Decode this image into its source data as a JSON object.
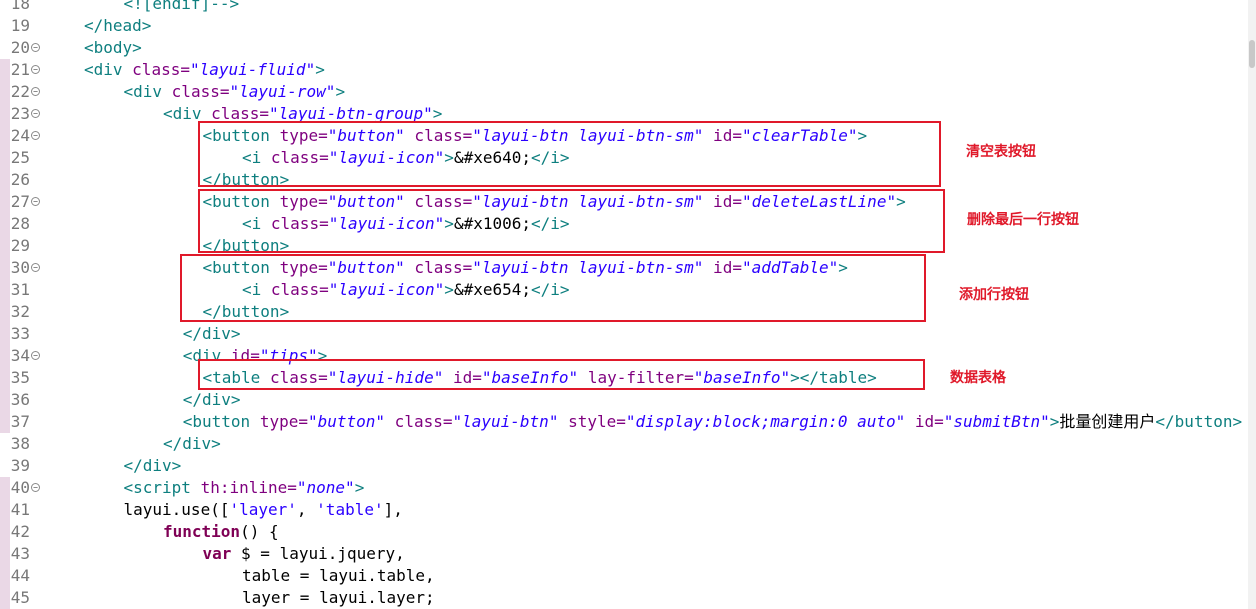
{
  "lines": [
    {
      "n": "18",
      "fold": false,
      "mark": false,
      "indent": 3,
      "tokens": [
        {
          "t": "<![endif]-->",
          "c": "tag"
        }
      ]
    },
    {
      "n": "19",
      "fold": false,
      "mark": false,
      "indent": 2,
      "tokens": [
        {
          "t": "</head>",
          "c": "tag"
        }
      ]
    },
    {
      "n": "20",
      "fold": true,
      "mark": false,
      "indent": 2,
      "tokens": [
        {
          "t": "<body>",
          "c": "tag"
        }
      ]
    },
    {
      "n": "21",
      "fold": true,
      "mark": true,
      "indent": 2,
      "tokens": [
        {
          "t": "<div ",
          "c": "tag"
        },
        {
          "t": "class=",
          "c": "attr"
        },
        {
          "t": "\"layui-fluid\"",
          "c": "str"
        },
        {
          "t": ">",
          "c": "tag"
        }
      ]
    },
    {
      "n": "22",
      "fold": true,
      "mark": true,
      "indent": 3,
      "tokens": [
        {
          "t": "<div ",
          "c": "tag"
        },
        {
          "t": "class=",
          "c": "attr"
        },
        {
          "t": "\"layui-row\"",
          "c": "str"
        },
        {
          "t": ">",
          "c": "tag"
        }
      ]
    },
    {
      "n": "23",
      "fold": true,
      "mark": true,
      "indent": 4,
      "tokens": [
        {
          "t": "<div ",
          "c": "tag"
        },
        {
          "t": "class=",
          "c": "attr"
        },
        {
          "t": "\"layui-btn-group\"",
          "c": "str"
        },
        {
          "t": ">",
          "c": "tag"
        }
      ]
    },
    {
      "n": "24",
      "fold": true,
      "mark": true,
      "indent": 5,
      "tokens": [
        {
          "t": "<button ",
          "c": "tag"
        },
        {
          "t": "type=",
          "c": "attr"
        },
        {
          "t": "\"button\"",
          "c": "str"
        },
        {
          "t": " class=",
          "c": "attr"
        },
        {
          "t": "\"layui-btn layui-btn-sm\"",
          "c": "str"
        },
        {
          "t": " id=",
          "c": "attr"
        },
        {
          "t": "\"clearTable\"",
          "c": "str"
        },
        {
          "t": ">",
          "c": "tag"
        }
      ]
    },
    {
      "n": "25",
      "fold": false,
      "mark": true,
      "indent": 6,
      "tokens": [
        {
          "t": "<i ",
          "c": "tag"
        },
        {
          "t": "class=",
          "c": "attr"
        },
        {
          "t": "\"layui-icon\"",
          "c": "str"
        },
        {
          "t": ">",
          "c": "tag"
        },
        {
          "t": "&#xe640;",
          "c": "plain"
        },
        {
          "t": "</i>",
          "c": "tag"
        }
      ]
    },
    {
      "n": "26",
      "fold": false,
      "mark": true,
      "indent": 5,
      "tokens": [
        {
          "t": "</button>",
          "c": "tag"
        }
      ]
    },
    {
      "n": "27",
      "fold": true,
      "mark": true,
      "indent": 5,
      "tokens": [
        {
          "t": "<button ",
          "c": "tag"
        },
        {
          "t": "type=",
          "c": "attr"
        },
        {
          "t": "\"button\"",
          "c": "str"
        },
        {
          "t": " class=",
          "c": "attr"
        },
        {
          "t": "\"layui-btn layui-btn-sm\"",
          "c": "str"
        },
        {
          "t": " id=",
          "c": "attr"
        },
        {
          "t": "\"deleteLastLine\"",
          "c": "str"
        },
        {
          "t": ">",
          "c": "tag"
        }
      ]
    },
    {
      "n": "28",
      "fold": false,
      "mark": true,
      "indent": 6,
      "tokens": [
        {
          "t": "<i ",
          "c": "tag"
        },
        {
          "t": "class=",
          "c": "attr"
        },
        {
          "t": "\"layui-icon\"",
          "c": "str"
        },
        {
          "t": ">",
          "c": "tag"
        },
        {
          "t": "&#x1006;",
          "c": "plain"
        },
        {
          "t": "</i>",
          "c": "tag"
        }
      ]
    },
    {
      "n": "29",
      "fold": false,
      "mark": true,
      "indent": 5,
      "tokens": [
        {
          "t": "</button>",
          "c": "tag"
        }
      ]
    },
    {
      "n": "30",
      "fold": true,
      "mark": true,
      "indent": 5,
      "tokens": [
        {
          "t": "<button ",
          "c": "tag"
        },
        {
          "t": "type=",
          "c": "attr"
        },
        {
          "t": "\"button\"",
          "c": "str"
        },
        {
          "t": " class=",
          "c": "attr"
        },
        {
          "t": "\"layui-btn layui-btn-sm\"",
          "c": "str"
        },
        {
          "t": " id=",
          "c": "attr"
        },
        {
          "t": "\"addTable\"",
          "c": "str"
        },
        {
          "t": ">",
          "c": "tag"
        }
      ]
    },
    {
      "n": "31",
      "fold": false,
      "mark": true,
      "indent": 6,
      "tokens": [
        {
          "t": "<i ",
          "c": "tag"
        },
        {
          "t": "class=",
          "c": "attr"
        },
        {
          "t": "\"layui-icon\"",
          "c": "str"
        },
        {
          "t": ">",
          "c": "tag"
        },
        {
          "t": "&#xe654;",
          "c": "plain"
        },
        {
          "t": "</i>",
          "c": "tag"
        }
      ]
    },
    {
      "n": "32",
      "fold": false,
      "mark": true,
      "indent": 5,
      "tokens": [
        {
          "t": "</button>",
          "c": "tag"
        }
      ]
    },
    {
      "n": "33",
      "fold": false,
      "mark": true,
      "indent": 4.5,
      "tokens": [
        {
          "t": "</div>",
          "c": "tag"
        }
      ]
    },
    {
      "n": "34",
      "fold": true,
      "mark": true,
      "indent": 4.5,
      "tokens": [
        {
          "t": "<div ",
          "c": "tag"
        },
        {
          "t": "id=",
          "c": "attr"
        },
        {
          "t": "\"tips\"",
          "c": "str"
        },
        {
          "t": ">",
          "c": "tag"
        }
      ]
    },
    {
      "n": "35",
      "fold": false,
      "mark": true,
      "indent": 5,
      "tokens": [
        {
          "t": "<table ",
          "c": "tag"
        },
        {
          "t": "class=",
          "c": "attr"
        },
        {
          "t": "\"layui-hide\"",
          "c": "str"
        },
        {
          "t": " id=",
          "c": "attr"
        },
        {
          "t": "\"baseInfo\"",
          "c": "str"
        },
        {
          "t": " lay-filter=",
          "c": "attr"
        },
        {
          "t": "\"baseInfo\"",
          "c": "str"
        },
        {
          "t": "></table>",
          "c": "tag"
        }
      ]
    },
    {
      "n": "36",
      "fold": false,
      "mark": true,
      "indent": 4.5,
      "tokens": [
        {
          "t": "</div>",
          "c": "tag"
        }
      ]
    },
    {
      "n": "37",
      "fold": false,
      "mark": true,
      "indent": 4.5,
      "tokens": [
        {
          "t": "<button ",
          "c": "tag"
        },
        {
          "t": "type=",
          "c": "attr"
        },
        {
          "t": "\"button\"",
          "c": "str"
        },
        {
          "t": " class=",
          "c": "attr"
        },
        {
          "t": "\"layui-btn\"",
          "c": "str"
        },
        {
          "t": " style=",
          "c": "attr"
        },
        {
          "t": "\"display:block;margin:0 auto\"",
          "c": "str"
        },
        {
          "t": " id=",
          "c": "attr"
        },
        {
          "t": "\"submitBtn\"",
          "c": "str"
        },
        {
          "t": ">",
          "c": "tag"
        },
        {
          "t": "批量创建用户",
          "c": "plain"
        },
        {
          "t": "</button>",
          "c": "tag"
        }
      ]
    },
    {
      "n": "38",
      "fold": false,
      "mark": false,
      "indent": 4,
      "tokens": [
        {
          "t": "</div>",
          "c": "tag"
        }
      ]
    },
    {
      "n": "39",
      "fold": false,
      "mark": false,
      "indent": 3,
      "tokens": [
        {
          "t": "</div>",
          "c": "tag"
        }
      ]
    },
    {
      "n": "40",
      "fold": true,
      "mark": true,
      "indent": 3,
      "tokens": [
        {
          "t": "<script ",
          "c": "tag"
        },
        {
          "t": "th:inline=",
          "c": "attr"
        },
        {
          "t": "\"none\"",
          "c": "str"
        },
        {
          "t": ">",
          "c": "tag"
        }
      ]
    },
    {
      "n": "41",
      "fold": false,
      "mark": true,
      "indent": 3,
      "tokens": [
        {
          "t": "layui.use([",
          "c": "plain"
        },
        {
          "t": "'layer'",
          "c": "jsstr"
        },
        {
          "t": ", ",
          "c": "plain"
        },
        {
          "t": "'table'",
          "c": "jsstr"
        },
        {
          "t": "],",
          "c": "plain"
        }
      ]
    },
    {
      "n": "42",
      "fold": false,
      "mark": true,
      "indent": 4,
      "tokens": [
        {
          "t": "function",
          "c": "kw"
        },
        {
          "t": "() {",
          "c": "plain"
        }
      ]
    },
    {
      "n": "43",
      "fold": false,
      "mark": true,
      "indent": 5,
      "tokens": [
        {
          "t": "var",
          "c": "kw"
        },
        {
          "t": " $ = layui.jquery,",
          "c": "plain"
        }
      ]
    },
    {
      "n": "44",
      "fold": false,
      "mark": true,
      "indent": 6,
      "tokens": [
        {
          "t": "table = layui.table,",
          "c": "plain"
        }
      ]
    },
    {
      "n": "45",
      "fold": false,
      "mark": true,
      "indent": 6,
      "tokens": [
        {
          "t": "layer = layui.layer;",
          "c": "plain"
        }
      ]
    }
  ],
  "annotations": [
    {
      "id": "clear",
      "label": "清空表按钮"
    },
    {
      "id": "delete",
      "label": "删除最后一行按钮"
    },
    {
      "id": "add",
      "label": "添加行按钮"
    },
    {
      "id": "table",
      "label": "数据表格"
    }
  ],
  "colors": {
    "highlight": "#e0192a",
    "tag": "#0e7f7f",
    "attr": "#7f007f",
    "string": "#2a00ff",
    "keyword": "#7f0055"
  }
}
